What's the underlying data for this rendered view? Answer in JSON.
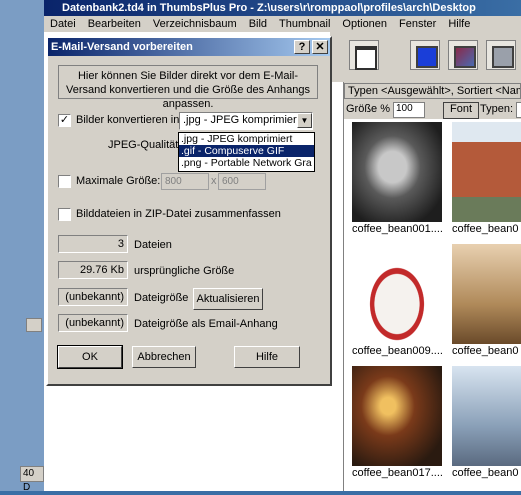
{
  "app": {
    "title": "Datenbank2.td4 in ThumbsPlus Pro - Z:\\users\\r\\romppaol\\profiles\\arch\\Desktop",
    "menu": [
      "Datei",
      "Bearbeiten",
      "Verzeichnisbaum",
      "Bild",
      "Thumbnail",
      "Optionen",
      "Fenster",
      "Hilfe"
    ],
    "filter_text": "Typen <Ausgewählt>, Sortiert <Name",
    "size_label": "Größe %",
    "size_value": "100",
    "font_button": "Font",
    "types_label": "Typen:",
    "status_left": "40 D",
    "thumbnails": [
      {
        "caption": "coffee_bean001...."
      },
      {
        "caption": "coffee_bean0"
      },
      {
        "caption": "coffee_bean009...."
      },
      {
        "caption": "coffee_bean0"
      },
      {
        "caption": "coffee_bean017...."
      },
      {
        "caption": "coffee_bean0"
      }
    ]
  },
  "dialog": {
    "title": "E-Mail-Versand vorbereiten",
    "help_caption_btn": "?",
    "close_caption_btn": "✕",
    "info": "Hier können Sie Bilder direkt vor dem E-Mail-Versand konvertieren und die Größe des Anhangs anpassen.",
    "convert_label": "Bilder konvertieren in:",
    "convert_checked": true,
    "format_selected": ".jpg - JPEG komprimiert",
    "format_options": [
      ".jpg - JPEG komprimiert",
      ".gif - Compuserve GIF",
      ".png - Portable Network Gra"
    ],
    "jpeg_quality_label": "JPEG-Qualität:",
    "max_size_label": "Maximale Größe:",
    "max_width": "800",
    "times": "x",
    "max_height": "600",
    "zip_label": "Bilddateien in ZIP-Datei zusammenfassen",
    "files_count": "3",
    "files_label": "Dateien",
    "orig_size": "29.76 Kb",
    "orig_size_label": "ursprüngliche Größe",
    "file_size_value": "(unbekannt)",
    "file_size_label": "Dateigröße",
    "update_button": "Aktualisieren",
    "attach_size_value": "(unbekannt)",
    "attach_size_label": "Dateigröße als Email-Anhang",
    "ok_button": "OK",
    "cancel_button": "Abbrechen",
    "help_button": "Hilfe"
  },
  "colors": {
    "titlebar": "#0a246a",
    "face": "#d4d0c8",
    "selection": "#0a246a"
  }
}
